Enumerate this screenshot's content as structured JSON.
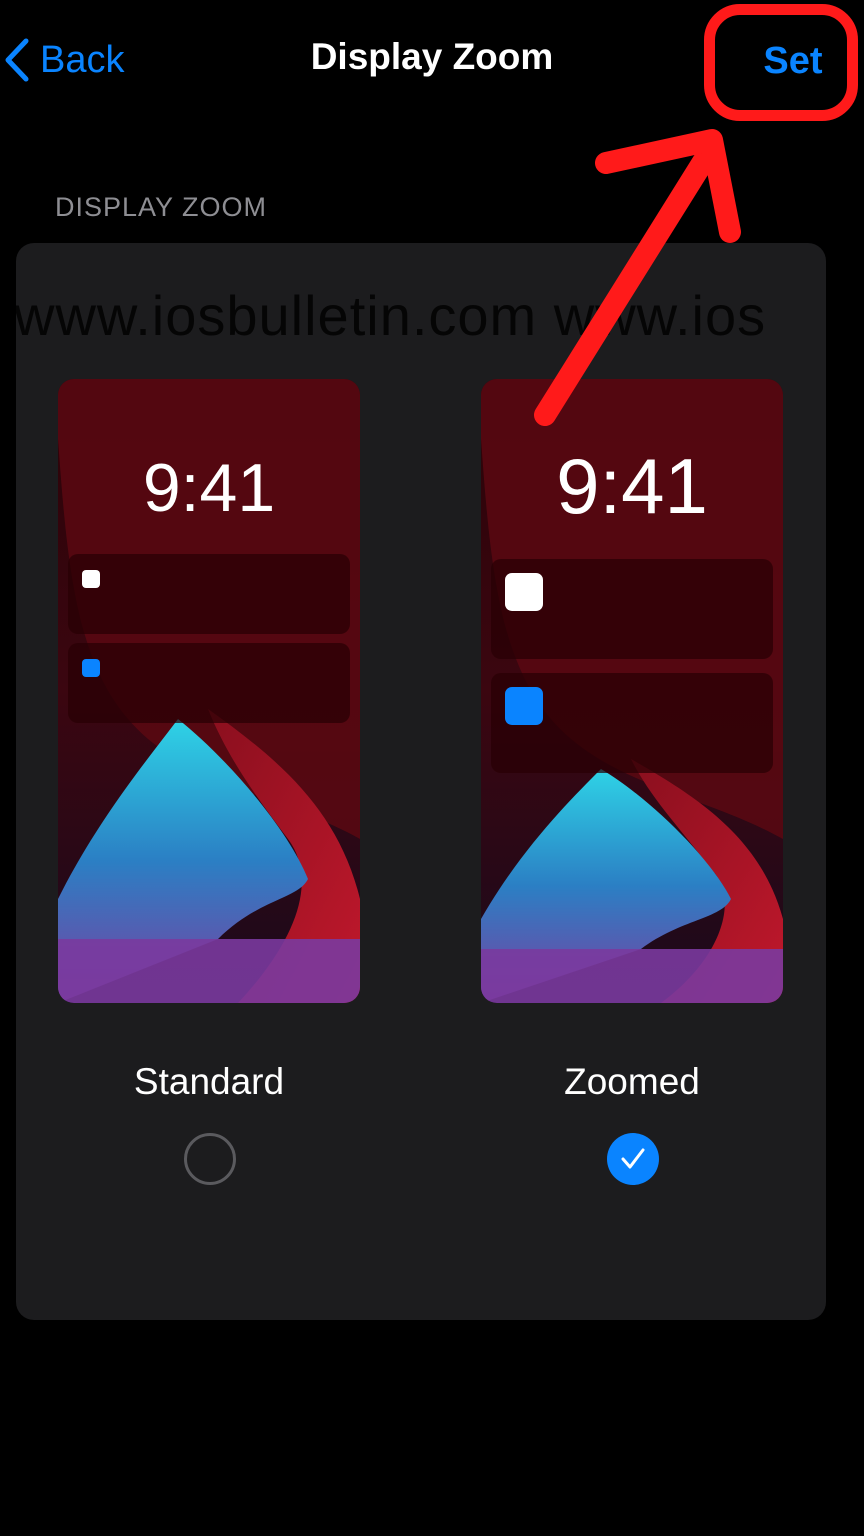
{
  "nav": {
    "back_label": "Back",
    "title": "Display Zoom",
    "set_label": "Set"
  },
  "section": {
    "header": "DISPLAY ZOOM",
    "watermark": "www.iosbulletin.com    www.ios"
  },
  "options": [
    {
      "id": "standard",
      "label": "Standard",
      "clock": "9:41",
      "selected": false
    },
    {
      "id": "zoomed",
      "label": "Zoomed",
      "clock": "9:41",
      "selected": true
    }
  ],
  "icons": {
    "back": "chevron-left-icon",
    "check": "checkmark-icon",
    "notification_white": "white-square-icon",
    "notification_blue": "blue-square-icon"
  },
  "colors": {
    "accent": "#0a84ff",
    "background": "#000000",
    "card": "#1c1c1e",
    "secondary_text": "#8e8e93",
    "annotation": "#ff1a1a"
  }
}
